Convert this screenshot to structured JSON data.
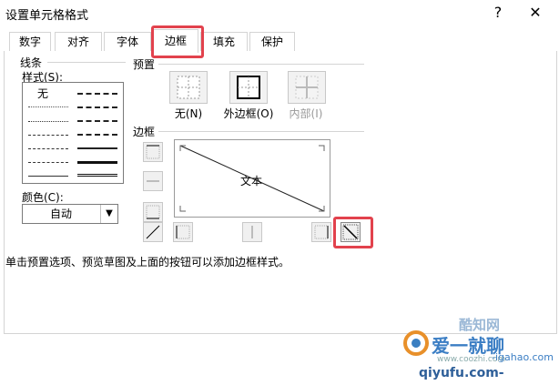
{
  "window": {
    "title": "设置单元格格式",
    "help": "?",
    "close": "✕"
  },
  "tabs": [
    {
      "label": "数字"
    },
    {
      "label": "对齐"
    },
    {
      "label": "字体"
    },
    {
      "label": "边框",
      "active": true
    },
    {
      "label": "填充"
    },
    {
      "label": "保护"
    }
  ],
  "line": {
    "group_label": "线条",
    "style_label": "样式(S):",
    "none_label": "无",
    "color_label": "颜色(C):",
    "color_value": "自动"
  },
  "presets": {
    "group_label": "预置",
    "items": [
      {
        "label": "无(N)"
      },
      {
        "label": "外边框(O)"
      },
      {
        "label": "内部(I)",
        "disabled": true
      }
    ]
  },
  "border": {
    "group_label": "边框",
    "preview_text": "文本"
  },
  "info_text": "单击预置选项、预览草图及上面的按钮可以添加边框样式。",
  "watermark": {
    "line1": "酷知网",
    "line2": "爱一就聊",
    "line3": "www.coozhi.com",
    "line4": "-igahao.com",
    "line5": "qiyufu.com-"
  },
  "colors": {
    "highlight": "#e2424d",
    "border": "#d4d4d4"
  }
}
